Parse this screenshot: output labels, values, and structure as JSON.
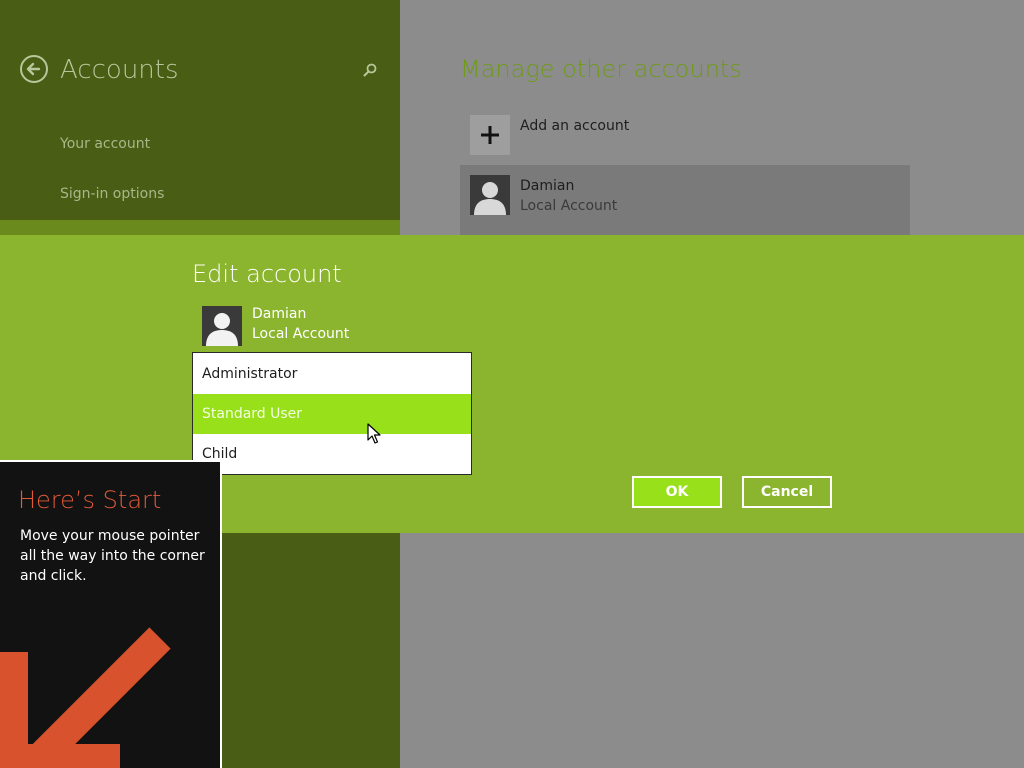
{
  "left_pane": {
    "title": "Accounts",
    "nav": [
      "Your account",
      "Sign-in options"
    ]
  },
  "right_pane": {
    "title": "Manage other accounts",
    "add_label": "Add an account",
    "accounts": [
      {
        "name": "Damian",
        "type": "Local Account"
      }
    ]
  },
  "dialog": {
    "title": "Edit account",
    "user_name": "Damian",
    "user_type": "Local Account",
    "options": [
      "Administrator",
      "Standard User",
      "Child"
    ],
    "selected": "Standard User",
    "ok_label": "OK",
    "cancel_label": "Cancel"
  },
  "start_tip": {
    "title": "Here’s Start",
    "text": "Move your mouse pointer all the way into the corner and click."
  },
  "colors": {
    "dialog_bg": "#8bb52e",
    "accent": "#97e01a",
    "left_pane_bg": "#4a5d14",
    "tip_title": "#e05a38",
    "tip_arrow": "#d9522e"
  }
}
